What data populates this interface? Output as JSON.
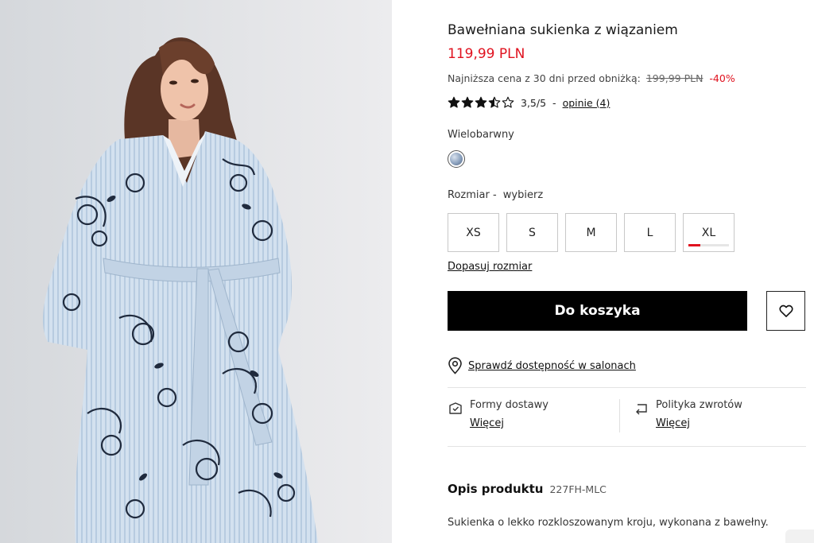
{
  "product": {
    "title": "Bawełniana sukienka z wiązaniem",
    "price": "119,99 PLN",
    "lowest_price_label": "Najniższa cena z 30 dni przed obniżką:",
    "old_price": "199,99 PLN",
    "discount": "-40%",
    "rating": {
      "value": 3.5,
      "max": 5,
      "score_text": "3,5/5",
      "separator": "-",
      "reviews_link": "opinie (4)"
    },
    "color": {
      "label": "Wielobarwny"
    },
    "size": {
      "label": "Rozmiar -",
      "choose_text": "wybierz",
      "options": [
        {
          "label": "XS",
          "low_stock": false
        },
        {
          "label": "S",
          "low_stock": false
        },
        {
          "label": "M",
          "low_stock": false
        },
        {
          "label": "L",
          "low_stock": false
        },
        {
          "label": "XL",
          "low_stock": true,
          "stock_level": 0.3
        }
      ],
      "fit_link": "Dopasuj rozmiar"
    },
    "cart_button": "Do koszyka",
    "availability_link": "Sprawdź dostępność w salonach",
    "delivery": {
      "title": "Formy dostawy",
      "more": "Więcej"
    },
    "returns": {
      "title": "Polityka zwrotów",
      "more": "Więcej"
    },
    "description": {
      "heading": "Opis produktu",
      "code": "227FH-MLC",
      "text": "Sukienka o lekko rozkloszowanym kroju, wykonana z bawełny."
    }
  },
  "icons": {
    "wishlist": "heart-icon",
    "availability": "map-pin-icon",
    "delivery": "box-icon",
    "returns": "return-arrow-icon"
  },
  "colors": {
    "accent_red": "#e0121f",
    "cart_button_bg": "#000000",
    "dress_base": "#c9d9ea",
    "print_ink": "#1f2a3d"
  }
}
